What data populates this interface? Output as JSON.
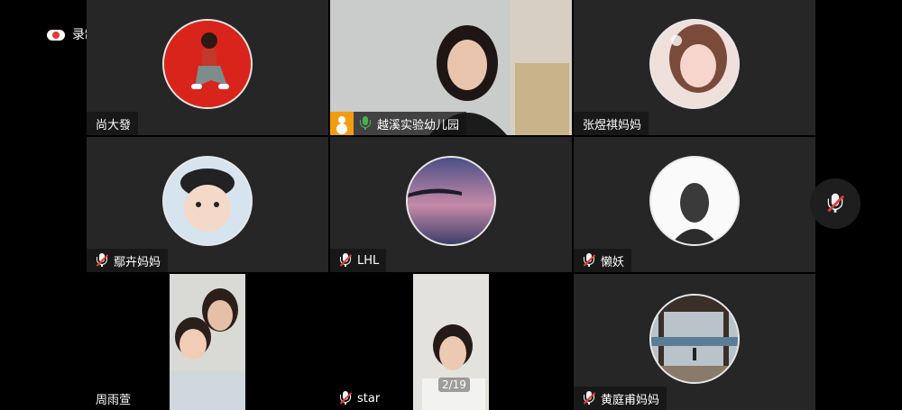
{
  "status": {
    "recording_label": "录制中"
  },
  "participants": [
    {
      "name": "尚大發",
      "mic": "none"
    },
    {
      "name": "越溪实验幼儿园",
      "mic": "on",
      "host": true,
      "active": true
    },
    {
      "name": "张煜祺妈妈",
      "mic": "none"
    },
    {
      "name": "鄢卉妈妈",
      "mic": "muted"
    },
    {
      "name": "LHL",
      "mic": "muted"
    },
    {
      "name": "懒妖",
      "mic": "muted"
    },
    {
      "name": "周雨萱",
      "mic": "none"
    },
    {
      "name": "star",
      "mic": "muted"
    },
    {
      "name": "黄庭甫妈妈",
      "mic": "muted"
    }
  ],
  "pager": {
    "label": "2/19"
  },
  "controls": {
    "floating_mic_icon": "mic-muted-icon"
  }
}
